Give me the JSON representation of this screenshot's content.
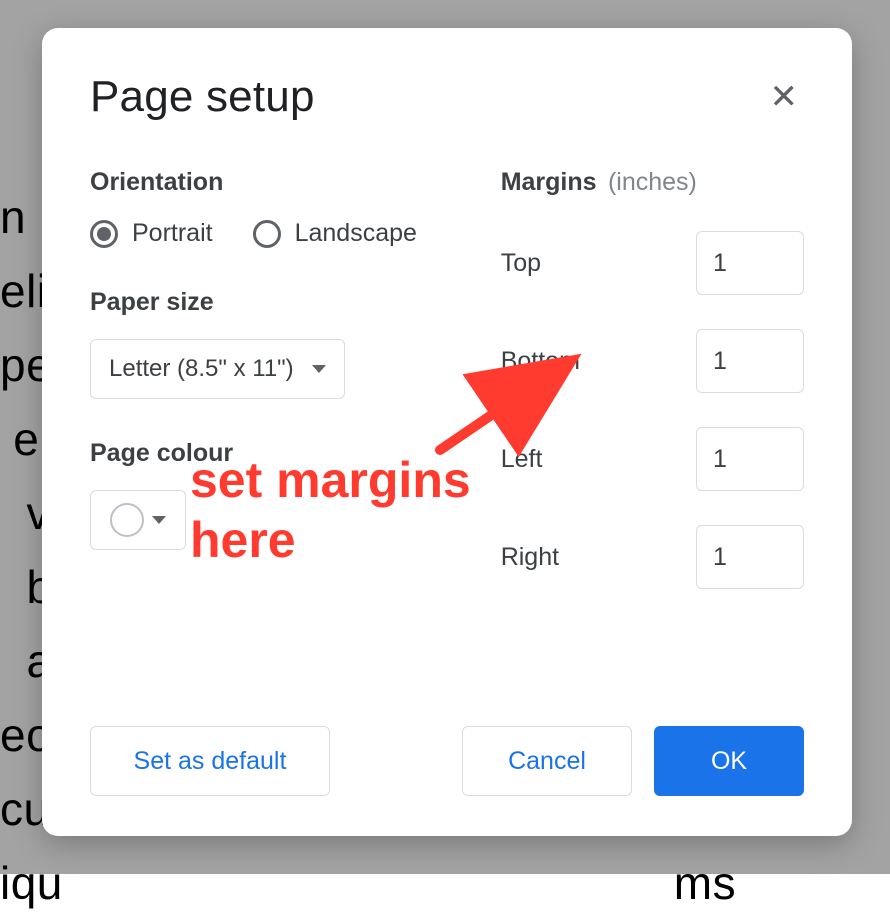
{
  "bg_text": "n                                              g\neli                                           n a\npe                                          dic\n e                                           n a\n  v                                            lig\n  b                                           ms\n  a                                            eu\neo                                              ul\ncu                                             lee\niqu                                              ms",
  "dialog": {
    "title": "Page setup",
    "orientation_label": "Orientation",
    "portrait_label": "Portrait",
    "landscape_label": "Landscape",
    "orientation_selected": "portrait",
    "paper_size_label": "Paper size",
    "paper_size_value": "Letter (8.5\" x 11\")",
    "page_color_label": "Page colour",
    "page_color_value": "#ffffff",
    "margins_label": "Margins",
    "margins_unit": "(inches)",
    "margins": [
      {
        "name": "Top",
        "value": "1"
      },
      {
        "name": "Bottom",
        "value": "1"
      },
      {
        "name": "Left",
        "value": "1"
      },
      {
        "name": "Right",
        "value": "1"
      }
    ],
    "buttons": {
      "set_default": "Set as default",
      "cancel": "Cancel",
      "ok": "OK"
    }
  },
  "annotation": {
    "text": "set margins\nhere",
    "arrow_color": "#ff3b2f"
  }
}
